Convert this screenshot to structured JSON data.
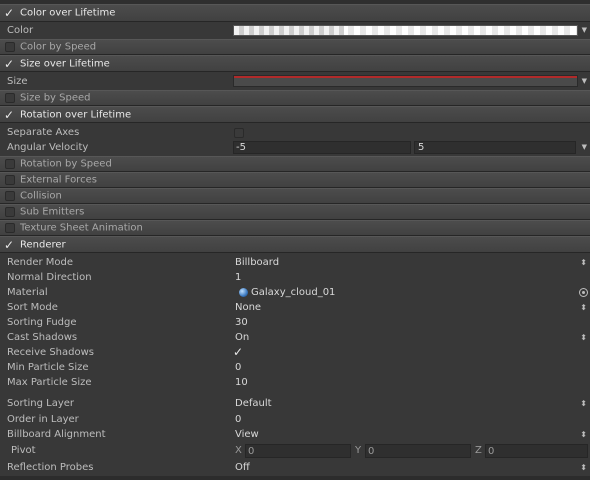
{
  "modules": {
    "color_over_lifetime": "Color over Lifetime",
    "color_by_speed": "Color by Speed",
    "size_over_lifetime": "Size over Lifetime",
    "size_by_speed": "Size by Speed",
    "rotation_over_lifetime": "Rotation over Lifetime",
    "rotation_by_speed": "Rotation by Speed",
    "external_forces": "External Forces",
    "collision": "Collision",
    "sub_emitters": "Sub Emitters",
    "texture_sheet_animation": "Texture Sheet Animation",
    "renderer": "Renderer"
  },
  "color_module": {
    "color_label": "Color"
  },
  "size_module": {
    "size_label": "Size"
  },
  "rotation_module": {
    "separate_axes_label": "Separate Axes",
    "angular_velocity_label": "Angular Velocity",
    "angular_velocity_min": "-5",
    "angular_velocity_max": "5"
  },
  "renderer": {
    "render_mode_label": "Render Mode",
    "render_mode": "Billboard",
    "normal_direction_label": "Normal Direction",
    "normal_direction": "1",
    "material_label": "Material",
    "material": "Galaxy_cloud_01",
    "sort_mode_label": "Sort Mode",
    "sort_mode": "None",
    "sorting_fudge_label": "Sorting Fudge",
    "sorting_fudge": "30",
    "cast_shadows_label": "Cast Shadows",
    "cast_shadows": "On",
    "receive_shadows_label": "Receive Shadows",
    "min_particle_size_label": "Min Particle Size",
    "min_particle_size": "0",
    "max_particle_size_label": "Max Particle Size",
    "max_particle_size": "10",
    "sorting_layer_label": "Sorting Layer",
    "sorting_layer": "Default",
    "order_in_layer_label": "Order in Layer",
    "order_in_layer": "0",
    "billboard_alignment_label": "Billboard Alignment",
    "billboard_alignment": "View",
    "pivot_label": "Pivot",
    "pivot_x_label": "X",
    "pivot_x": "0",
    "pivot_y_label": "Y",
    "pivot_y": "0",
    "pivot_z_label": "Z",
    "pivot_z": "0",
    "reflection_probes_label": "Reflection Probes",
    "reflection_probes": "Off"
  },
  "colors": {
    "size_curve": "#b02a2a",
    "panel": "#383838",
    "header": "#464646"
  },
  "icons": {
    "material": "sphere-icon",
    "object_picker": "target-circle-icon",
    "checked": "checkmark-icon"
  }
}
